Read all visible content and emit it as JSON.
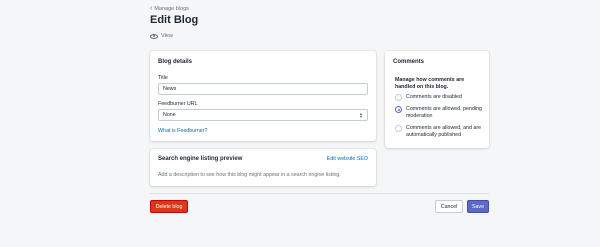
{
  "breadcrumb": {
    "label": "Manage blogs"
  },
  "page": {
    "title": "Edit Blog",
    "view_label": "View"
  },
  "blog_details": {
    "heading": "Blog details",
    "title_label": "Title",
    "title_value": "News",
    "feedburner_label": "Feedburner URL",
    "feedburner_value": "None",
    "feedburner_help": "What is Feedburner?"
  },
  "seo": {
    "heading": "Search engine listing preview",
    "edit_link": "Edit website SEO",
    "description": "Add a description to see how this blog might appear in a search engine listing."
  },
  "comments": {
    "heading": "Comments",
    "subheading": "Manage how comments are handled on this blog.",
    "options": [
      {
        "label": "Comments are disabled",
        "checked": false
      },
      {
        "label": "Comments are allowed, pending moderation",
        "checked": true
      },
      {
        "label": "Comments are allowed, and are automatically published",
        "checked": false
      }
    ]
  },
  "actions": {
    "delete_label": "Delete blog",
    "cancel_label": "Cancel",
    "save_label": "Save"
  },
  "colors": {
    "primary": "#5c6ac4",
    "danger": "#de3618",
    "link": "#006fbb",
    "background": "#f4f6f8"
  }
}
